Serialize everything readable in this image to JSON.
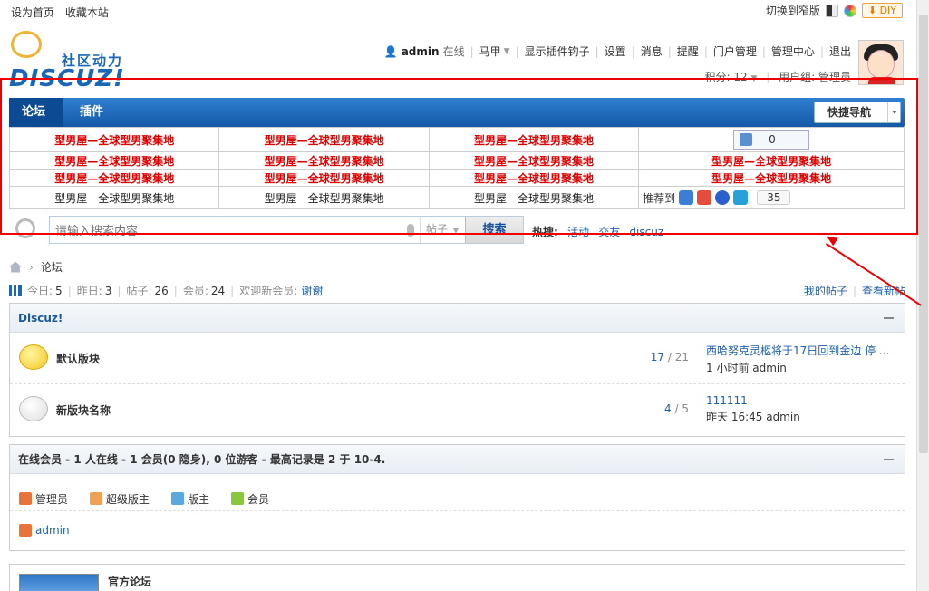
{
  "topbar": {
    "set_home": "设为首页",
    "bookmark": "收藏本站",
    "switch_style": "切换到窄版",
    "diy": "DIY"
  },
  "logo": {
    "slogan": "社区动力",
    "brand": "DISCUZ!"
  },
  "user": {
    "name": "admin",
    "status": "在线",
    "nav": [
      "马甲",
      "显示插件钩子",
      "设置",
      "消息",
      "提醒",
      "门户管理",
      "管理中心",
      "退出"
    ],
    "points_label": "积分: 12",
    "group_label": "用户组: 管理员"
  },
  "nav": {
    "items": [
      "论坛",
      "插件"
    ],
    "quick_nav": "快捷导航"
  },
  "link_grid": {
    "link_text": "型男屋—全球型男聚集地",
    "like_count": "0",
    "share_label": "推荐到",
    "share_count": "35"
  },
  "search": {
    "placeholder": "请输入搜索内容",
    "type": "帖子",
    "button": "搜索",
    "hot_label": "热搜:",
    "hot_items": [
      "活动",
      "交友",
      "discuz"
    ]
  },
  "breadcrumb": {
    "current": "论坛"
  },
  "stats": {
    "today_label": "今日:",
    "today": "5",
    "yesterday_label": "昨日:",
    "yesterday": "3",
    "posts_label": "帖子:",
    "posts": "26",
    "members_label": "会员:",
    "members": "24",
    "welcome_label": "欢迎新会员:",
    "welcome_user": "谢谢",
    "my_posts": "我的帖子",
    "new_posts": "查看新帖"
  },
  "forum_group": {
    "title": "Discuz!",
    "forums": [
      {
        "name": "默认版块",
        "threads": "17",
        "posts": "21",
        "last_title": "西哈努克灵柩将于17日回到金边 停 ...",
        "last_meta": "1 小时前 admin"
      },
      {
        "name": "新版块名称",
        "threads": "4",
        "posts": "5",
        "last_title": "111111",
        "last_meta": "昨天 16:45 admin"
      }
    ]
  },
  "online": {
    "title": "在线会员 - 1 人在线 - 1 会员(0 隐身), 0 位游客 - 最高记录是 2 于 10-4.",
    "legend": [
      "管理员",
      "超级版主",
      "版主",
      "会员"
    ],
    "users": [
      "admin"
    ]
  },
  "partner": {
    "title": "官方论坛"
  },
  "colors": {
    "accent": "#1a67b5",
    "link": "#1f5fa9",
    "highlight": "#e00000",
    "ad_text": "#dd0000"
  }
}
